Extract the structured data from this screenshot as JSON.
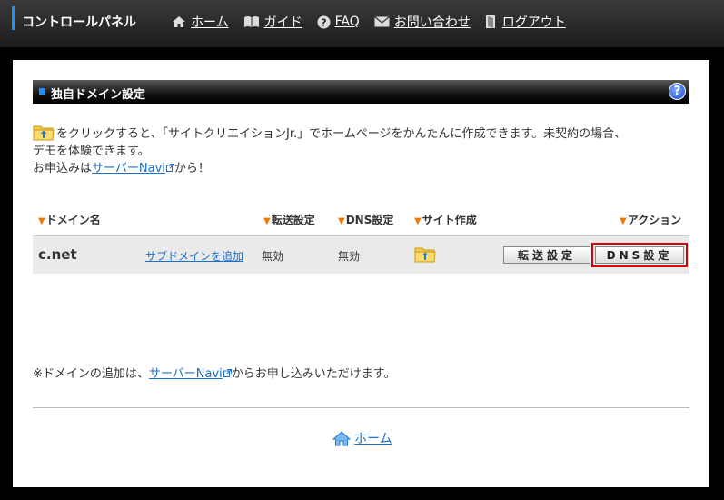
{
  "header": {
    "brand": "コントロールパネル",
    "nav": [
      {
        "label": "ホーム",
        "icon": "home-icon"
      },
      {
        "label": "ガイド",
        "icon": "book-icon"
      },
      {
        "label": "FAQ",
        "icon": "question-icon"
      },
      {
        "label": "お問い合わせ",
        "icon": "mail-icon"
      },
      {
        "label": "ログアウト",
        "icon": "door-icon"
      }
    ]
  },
  "section": {
    "title": "独自ドメイン設定",
    "help_icon": "?"
  },
  "intro": {
    "line1": "をクリックすると、「サイトクリエイションJr.」でホームページをかんたんに作成できます。未契約の場合、",
    "line2": "デモを体験できます。",
    "line3_prefix": "お申込みは",
    "line3_link": "サーバーNavi",
    "line3_suffix": "から！"
  },
  "table": {
    "headers": {
      "domain": "ドメイン名",
      "forward": "転送設定",
      "dns": "DNS設定",
      "site": "サイト作成",
      "action": "アクション"
    },
    "rows": [
      {
        "domain": "c.net",
        "subdomain_link": "サブドメインを追加",
        "forward": "無効",
        "dns": "無効",
        "btn_forward": "転送設定",
        "btn_dns": "DNS設定"
      }
    ]
  },
  "note": {
    "prefix": "※ドメインの追加は、",
    "link": "サーバーNavi",
    "suffix": "からお申し込みいただけます。"
  },
  "footer": {
    "home_label": "ホーム"
  },
  "colors": {
    "accent": "#1e90ff",
    "link": "#1a6fc9",
    "triangle": "#f07800",
    "highlight": "#e00000"
  }
}
